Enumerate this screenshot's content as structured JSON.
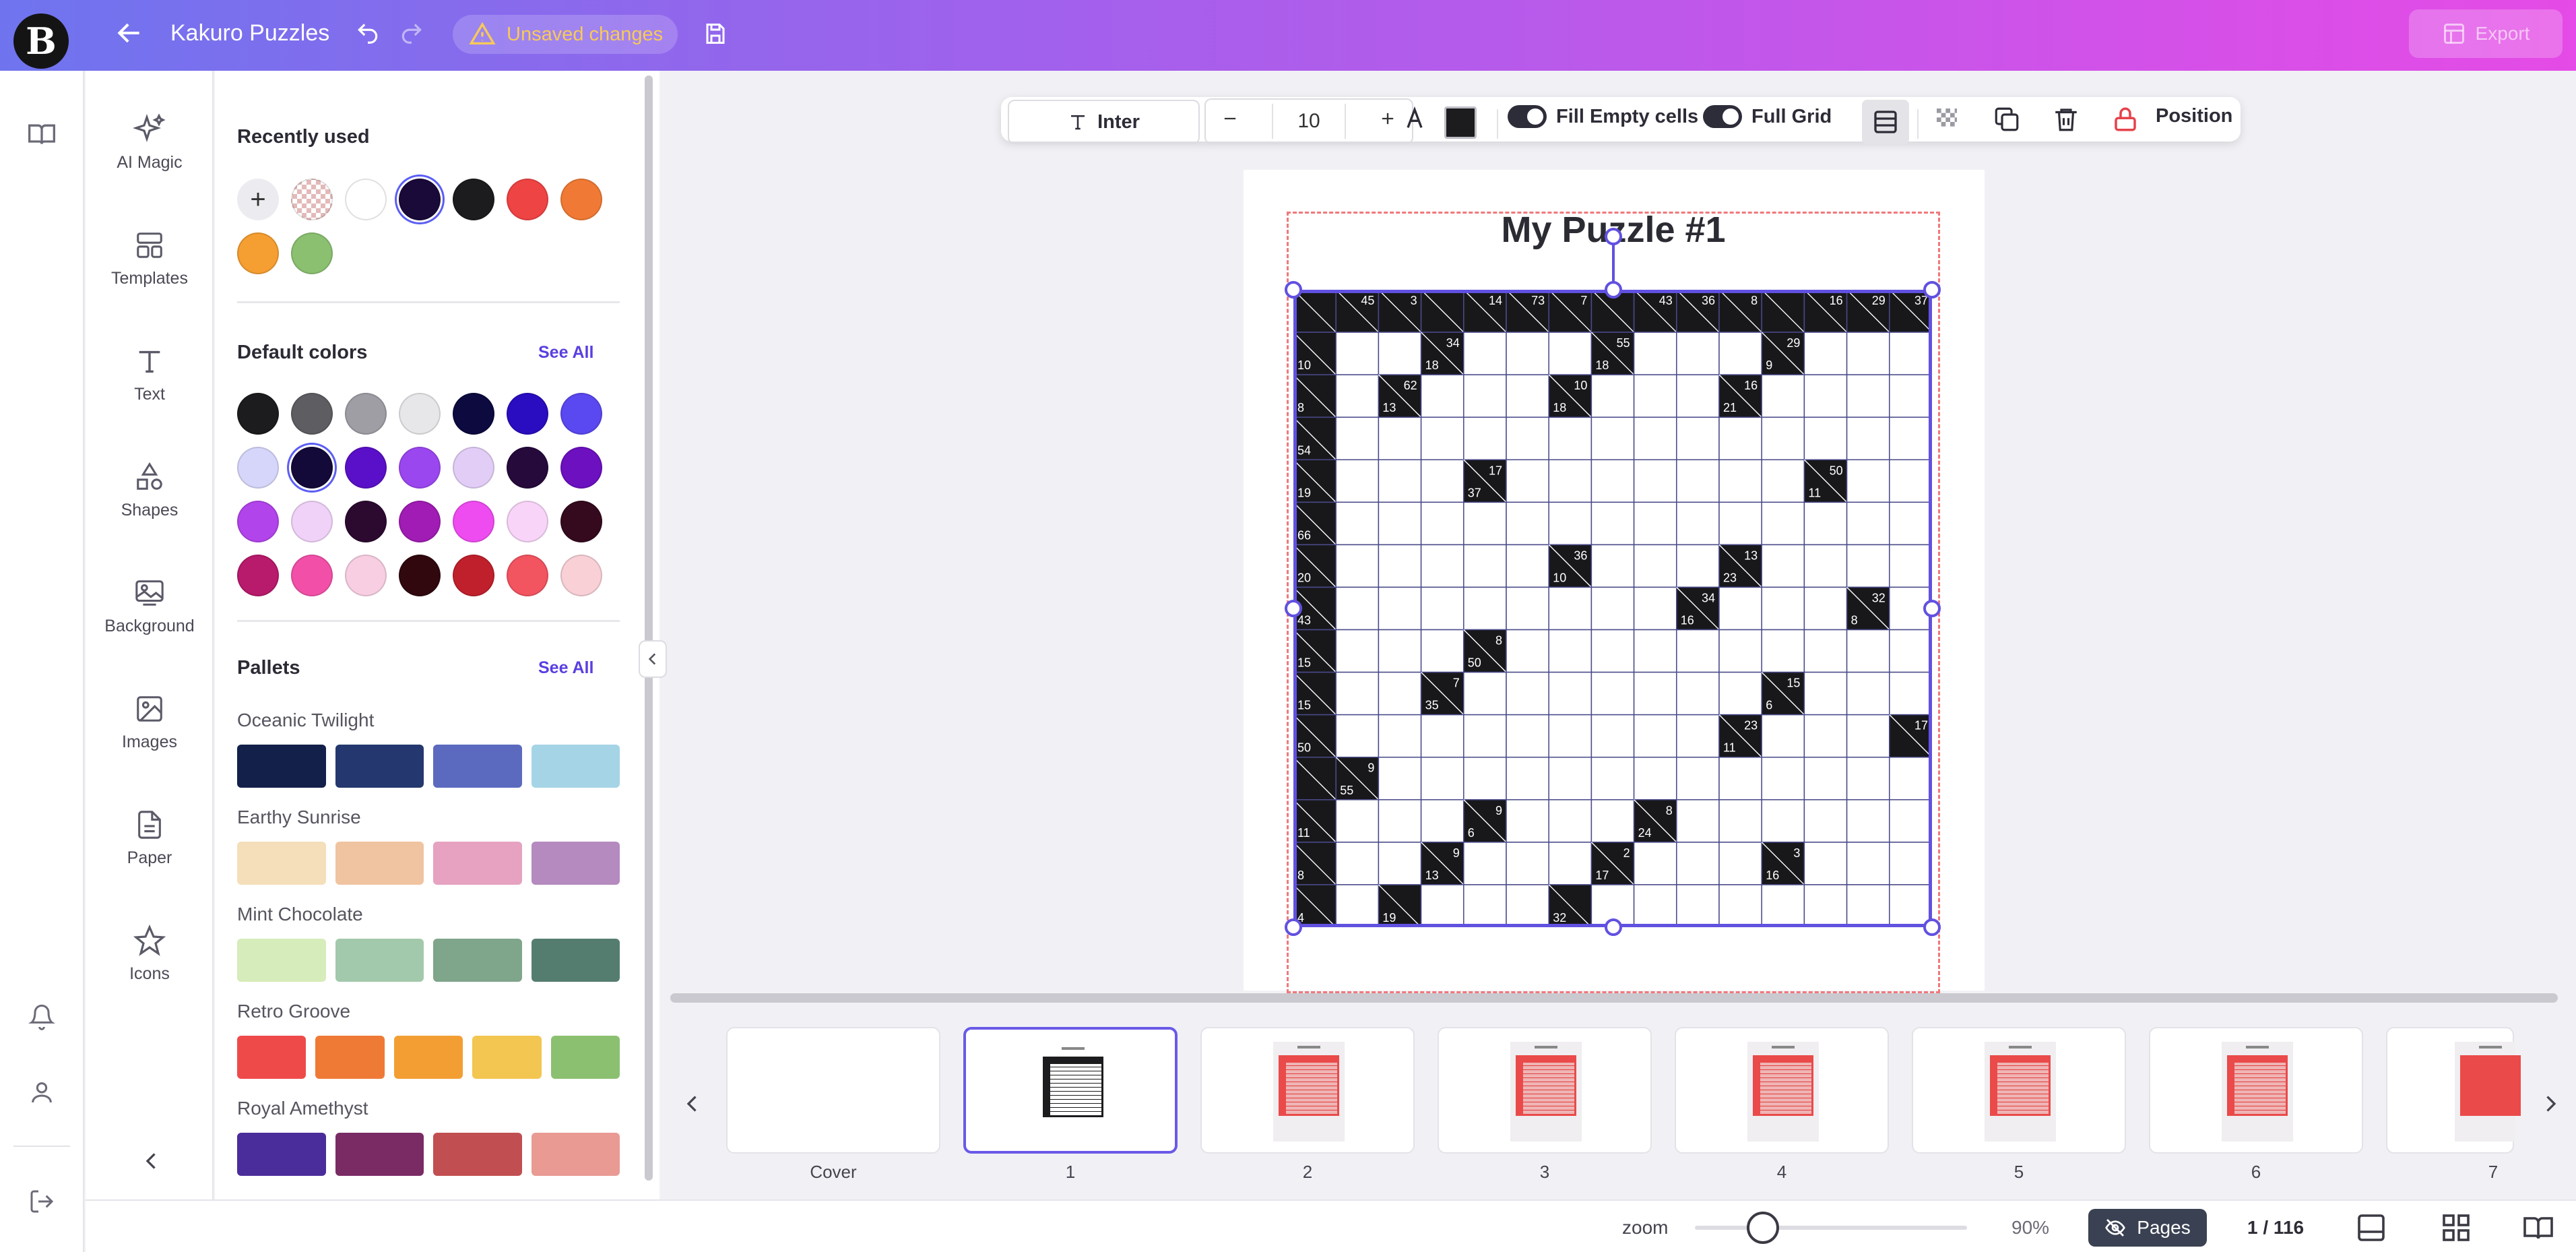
{
  "app": {
    "logo_letter": "B",
    "title": "Kakuro Puzzles",
    "unsaved_label": "Unsaved changes",
    "export_label": "Export"
  },
  "tools": [
    {
      "label": "AI Magic",
      "icon": "sparkles-icon"
    },
    {
      "label": "Templates",
      "icon": "templates-icon"
    },
    {
      "label": "Text",
      "icon": "text-icon"
    },
    {
      "label": "Shapes",
      "icon": "shapes-icon"
    },
    {
      "label": "Background",
      "icon": "background-icon"
    },
    {
      "label": "Images",
      "icon": "image-icon"
    },
    {
      "label": "Paper",
      "icon": "paper-icon"
    },
    {
      "label": "Icons",
      "icon": "star-icon"
    }
  ],
  "panel": {
    "recent_heading": "Recently used",
    "recent_colors": [
      "transparent",
      "#ffffff",
      "#1a0a3a",
      "#1c1c1e",
      "#ef4444",
      "#f07a35",
      "#f59e32",
      "#8bc071"
    ],
    "default_heading": "Default colors",
    "see_all": "See All",
    "default_colors": [
      "#1c1c1e",
      "#5d5d62",
      "#9e9ea4",
      "#e7e7ea",
      "#0c0a3f",
      "#2a0dc0",
      "#5a48f0",
      "#d6d6fa",
      "#140a3a",
      "#5a10c8",
      "#9b47f0",
      "#e2cdf6",
      "#260a3c",
      "#6c10c0",
      "#b244ec",
      "#f0d2f8",
      "#2c0a30",
      "#a01cb4",
      "#ee4cf0",
      "#f8d4f8",
      "#350a1e",
      "#b81a6c",
      "#f250a8",
      "#f8cee2",
      "#30080e",
      "#c0202c",
      "#f25460",
      "#f8d0d6"
    ],
    "pallets_heading": "Pallets",
    "pallets": [
      {
        "name": "Oceanic Twilight",
        "colors": [
          "#13204a",
          "#24376e",
          "#5b6abf",
          "#a5d4e6"
        ]
      },
      {
        "name": "Earthy Sunrise",
        "colors": [
          "#f4dfba",
          "#f0c4a0",
          "#e6a2c0",
          "#b48abf"
        ]
      },
      {
        "name": "Mint Chocolate",
        "colors": [
          "#d6ecba",
          "#a2c9ab",
          "#7fa58b",
          "#557d6f"
        ]
      },
      {
        "name": "Retro Groove",
        "colors": [
          "#ef4a4a",
          "#ef7a36",
          "#f39e33",
          "#f3c551",
          "#8cc071"
        ]
      },
      {
        "name": "Royal Amethyst",
        "colors": [
          "#4a2d9a",
          "#7a2b64",
          "#c14e50",
          "#e99a93"
        ]
      }
    ]
  },
  "toolbar": {
    "font": "Inter",
    "font_size": "10",
    "fill_empty_label": "Fill Empty cells",
    "full_grid_label": "Full Grid",
    "position_label": "Position",
    "color": "#1c1c1e"
  },
  "puzzle": {
    "title": "My Puzzle #1",
    "size": 15,
    "blocks": [
      {
        "r": 0,
        "c": 0
      },
      {
        "r": 0,
        "c": 1,
        "a": 45
      },
      {
        "r": 0,
        "c": 2,
        "a": 3
      },
      {
        "r": 0,
        "c": 3
      },
      {
        "r": 0,
        "c": 4,
        "a": 14
      },
      {
        "r": 0,
        "c": 5,
        "a": 73
      },
      {
        "r": 0,
        "c": 6,
        "a": 7
      },
      {
        "r": 0,
        "c": 7
      },
      {
        "r": 0,
        "c": 8,
        "a": 43
      },
      {
        "r": 0,
        "c": 9,
        "a": 36
      },
      {
        "r": 0,
        "c": 10,
        "a": 8
      },
      {
        "r": 0,
        "c": 11
      },
      {
        "r": 0,
        "c": 12,
        "a": 16
      },
      {
        "r": 0,
        "c": 13,
        "a": 29
      },
      {
        "r": 0,
        "c": 14,
        "a": 37
      },
      {
        "r": 1,
        "c": 0,
        "b": 10
      },
      {
        "r": 1,
        "c": 3,
        "a": 34,
        "b": 18
      },
      {
        "r": 1,
        "c": 7,
        "a": 55,
        "b": 18
      },
      {
        "r": 1,
        "c": 11,
        "a": 29,
        "b": 9
      },
      {
        "r": 2,
        "c": 0,
        "b": 8
      },
      {
        "r": 2,
        "c": 2,
        "a": 62,
        "b": 13
      },
      {
        "r": 2,
        "c": 6,
        "a": 10,
        "b": 18
      },
      {
        "r": 2,
        "c": 10,
        "a": 16,
        "b": 21
      },
      {
        "r": 3,
        "c": 0,
        "b": 54
      },
      {
        "r": 4,
        "c": 0,
        "b": 19
      },
      {
        "r": 4,
        "c": 4,
        "a": 17,
        "b": 37
      },
      {
        "r": 4,
        "c": 12,
        "a": 50,
        "b": 11
      },
      {
        "r": 5,
        "c": 0,
        "b": 66
      },
      {
        "r": 6,
        "c": 0,
        "b": 20
      },
      {
        "r": 6,
        "c": 6,
        "a": 36,
        "b": 10
      },
      {
        "r": 6,
        "c": 10,
        "a": 13,
        "b": 23
      },
      {
        "r": 7,
        "c": 0,
        "b": 43
      },
      {
        "r": 7,
        "c": 9,
        "a": 34,
        "b": 16
      },
      {
        "r": 7,
        "c": 13,
        "a": 32,
        "b": 8
      },
      {
        "r": 8,
        "c": 0,
        "b": 15
      },
      {
        "r": 8,
        "c": 4,
        "a": 8,
        "b": 50
      },
      {
        "r": 9,
        "c": 0,
        "b": 15
      },
      {
        "r": 9,
        "c": 3,
        "a": 7,
        "b": 35
      },
      {
        "r": 9,
        "c": 11,
        "a": 15,
        "b": 6
      },
      {
        "r": 10,
        "c": 0,
        "b": 50
      },
      {
        "r": 10,
        "c": 10,
        "a": 23,
        "b": 11
      },
      {
        "r": 10,
        "c": 14,
        "a": 17
      },
      {
        "r": 11,
        "c": 0
      },
      {
        "r": 11,
        "c": 1,
        "a": 9,
        "b": 55
      },
      {
        "r": 12,
        "c": 0,
        "b": 11
      },
      {
        "r": 12,
        "c": 4,
        "a": 9,
        "b": 6
      },
      {
        "r": 12,
        "c": 8,
        "a": 8,
        "b": 24
      },
      {
        "r": 13,
        "c": 0,
        "b": 8
      },
      {
        "r": 13,
        "c": 3,
        "a": 9,
        "b": 13
      },
      {
        "r": 13,
        "c": 7,
        "a": 2,
        "b": 17
      },
      {
        "r": 13,
        "c": 11,
        "a": 3,
        "b": 16
      },
      {
        "r": 14,
        "c": 0,
        "b": 4
      },
      {
        "r": 14,
        "c": 2,
        "b": 19
      },
      {
        "r": 14,
        "c": 6,
        "b": 32
      }
    ]
  },
  "pages": [
    {
      "label": "Cover",
      "style": "blank"
    },
    {
      "label": "1",
      "style": "dark"
    },
    {
      "label": "2",
      "style": "red"
    },
    {
      "label": "3",
      "style": "red"
    },
    {
      "label": "4",
      "style": "red"
    },
    {
      "label": "5",
      "style": "red"
    },
    {
      "label": "6",
      "style": "red"
    },
    {
      "label": "7",
      "style": "redbig"
    }
  ],
  "bottom": {
    "zoom_label": "zoom",
    "zoom_value": "90%",
    "zoom_fraction": 0.25,
    "pages_label": "Pages",
    "page_count": "1 / 116"
  }
}
